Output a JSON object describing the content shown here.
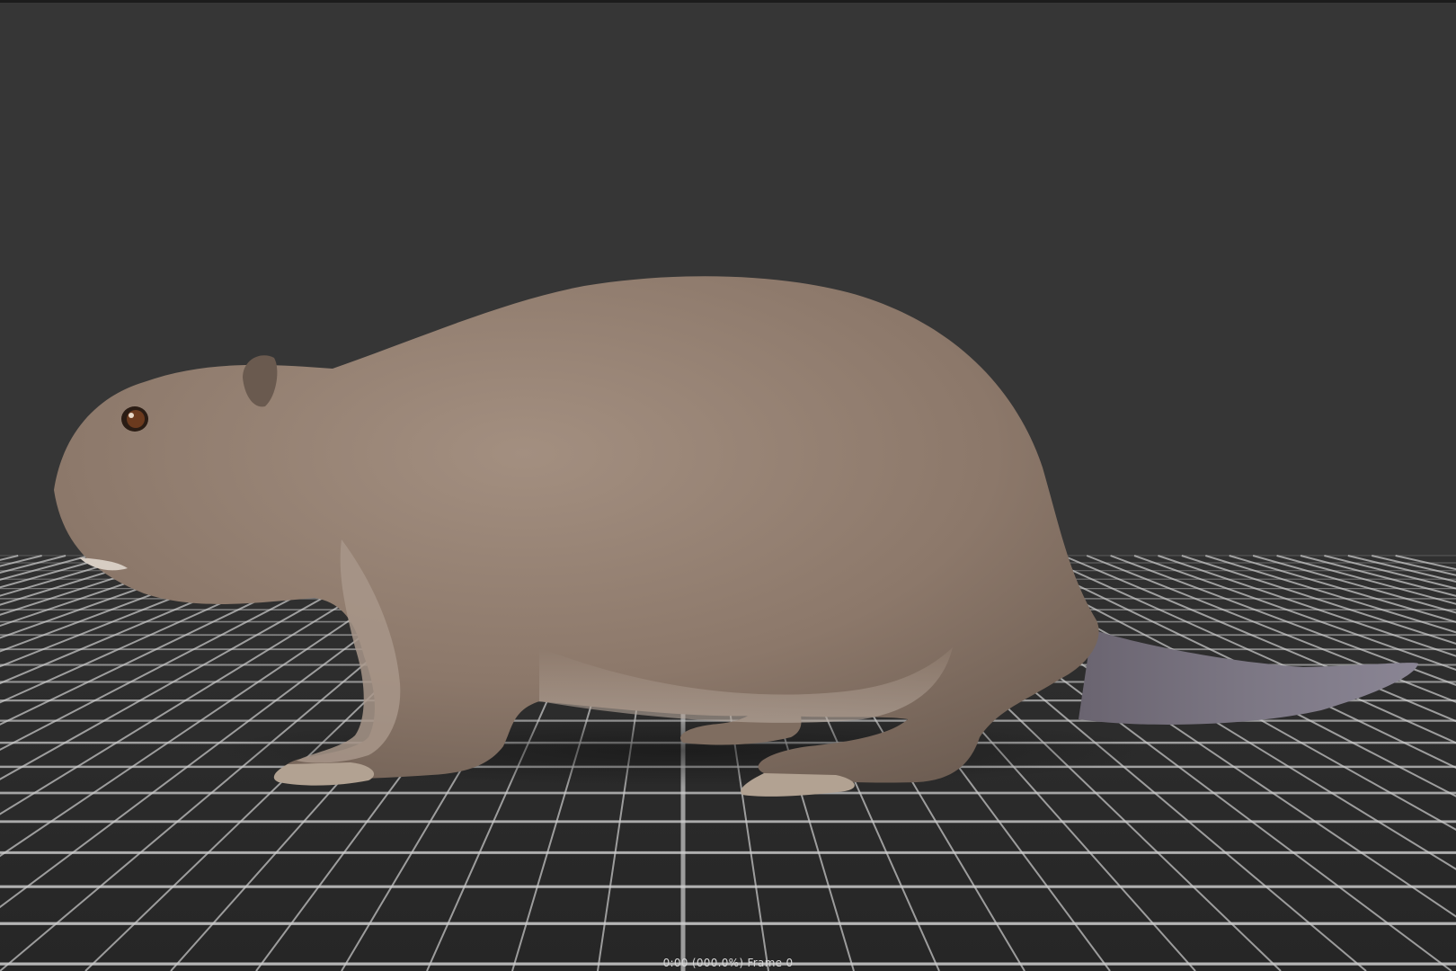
{
  "viewport": {
    "background_color": "#363636",
    "floor_line_color": "#cfcfcf",
    "floor_color": "#2e2e2e",
    "status_text": "0:00 (000.0%) Frame 0"
  },
  "model": {
    "icon": "beaver-model",
    "fur_color": "#8f7b6d",
    "fur_highlight": "#b3a192",
    "tail_color": "#7a7580",
    "eye_color": "#6b3a1e"
  }
}
